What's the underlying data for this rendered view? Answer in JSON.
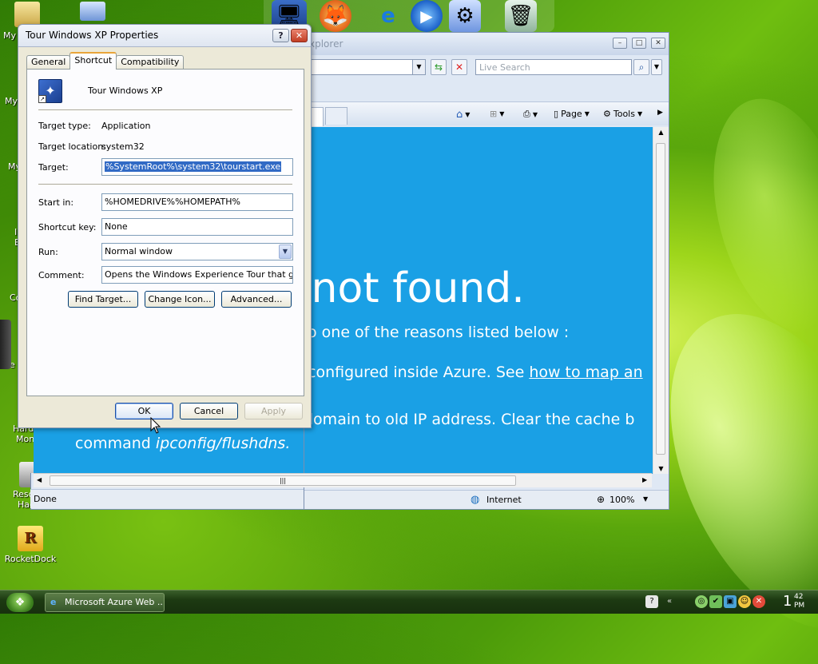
{
  "desktop": {
    "icons": [
      {
        "label": "RocketDock"
      }
    ],
    "partial_labels": [
      "My",
      "My",
      "My",
      "I",
      "E",
      "Co",
      "e",
      "Hard",
      "Mon",
      "Resc",
      "Hac"
    ]
  },
  "ie": {
    "title_fragment": "xplorer",
    "search_placeholder": "Live Search",
    "cmd_page": "Page",
    "cmd_tools": "Tools",
    "status_left": "Done",
    "zone": "Internet",
    "zoom": "100%",
    "content": {
      "heading": "e not found.",
      "line1": "o one of the reasons listed below :",
      "line2_prefix": "configured inside Azure. See ",
      "line2_link": "how to map an",
      "line3": " domain to old IP address. Clear the cache b",
      "line4_prefix": "command ",
      "line4_italic": "ipconfig/flushdns."
    }
  },
  "dialog": {
    "title": "Tour Windows XP Properties",
    "tabs": [
      "General",
      "Shortcut",
      "Compatibility"
    ],
    "active_tab": "Shortcut",
    "shortcut_name": "Tour Windows XP",
    "target_type_label": "Target type:",
    "target_type_value": "Application",
    "target_location_label": "Target location:",
    "target_location_value": "system32",
    "target_label": "Target:",
    "target_value": "%SystemRoot%\\system32\\tourstart.exe",
    "start_in_label": "Start in:",
    "start_in_value": "%HOMEDRIVE%%HOMEPATH%",
    "shortcut_key_label": "Shortcut key:",
    "shortcut_key_value": "None",
    "run_label": "Run:",
    "run_value": "Normal window",
    "comment_label": "Comment:",
    "comment_value": "Opens the Windows Experience Tour that guides",
    "find_target": "Find Target...",
    "change_icon": "Change Icon...",
    "advanced": "Advanced...",
    "ok": "OK",
    "cancel": "Cancel",
    "apply": "Apply"
  },
  "taskbar": {
    "task_label": "Microsoft Azure Web ...",
    "clock_hour": "1",
    "clock_min": "42",
    "clock_ampm": "PM"
  }
}
